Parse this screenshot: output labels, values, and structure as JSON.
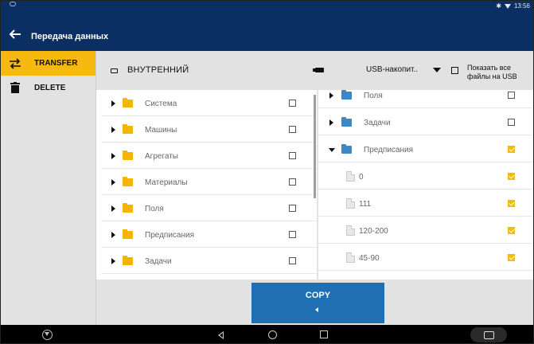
{
  "status_bar": {
    "time": "13:56"
  },
  "app_bar": {
    "title": "Передача данных"
  },
  "sidebar": {
    "items": [
      {
        "label": "TRANSFER",
        "icon": "transfer-icon",
        "active": true
      },
      {
        "label": "DELETE",
        "icon": "trash-icon",
        "active": false
      }
    ]
  },
  "header": {
    "internal_label": "ВНУТРЕННИЙ",
    "usb_selected": "USB-накопит..",
    "show_all_line1": "Показать все",
    "show_all_line2": "файлы на USB",
    "show_all_checked": false
  },
  "left_panel": {
    "rows": [
      {
        "label": "Система",
        "checked": false
      },
      {
        "label": "Машины",
        "checked": false
      },
      {
        "label": "Агрегаты",
        "checked": false
      },
      {
        "label": "Материалы",
        "checked": false
      },
      {
        "label": "Поля",
        "checked": false
      },
      {
        "label": "Предписания",
        "checked": false
      },
      {
        "label": "Задачи",
        "checked": false
      }
    ]
  },
  "right_panel": {
    "rows": [
      {
        "label": "Поля",
        "type": "folder",
        "expanded": false,
        "checked": false
      },
      {
        "label": "Задачи",
        "type": "folder",
        "expanded": false,
        "checked": false
      },
      {
        "label": "Предписания",
        "type": "folder",
        "expanded": true,
        "checked": true
      },
      {
        "label": "0",
        "type": "file",
        "checked": true
      },
      {
        "label": "111",
        "type": "file",
        "checked": true
      },
      {
        "label": "120-200",
        "type": "file",
        "checked": true
      },
      {
        "label": "45-90",
        "type": "file",
        "checked": true
      }
    ]
  },
  "copy_button": {
    "label": "COPY"
  },
  "colors": {
    "app_bar": "#0b2f63",
    "accent": "#f6b90f",
    "button": "#1f6fb4",
    "folder_internal": "#f5b400",
    "folder_usb": "#3a88c8"
  }
}
